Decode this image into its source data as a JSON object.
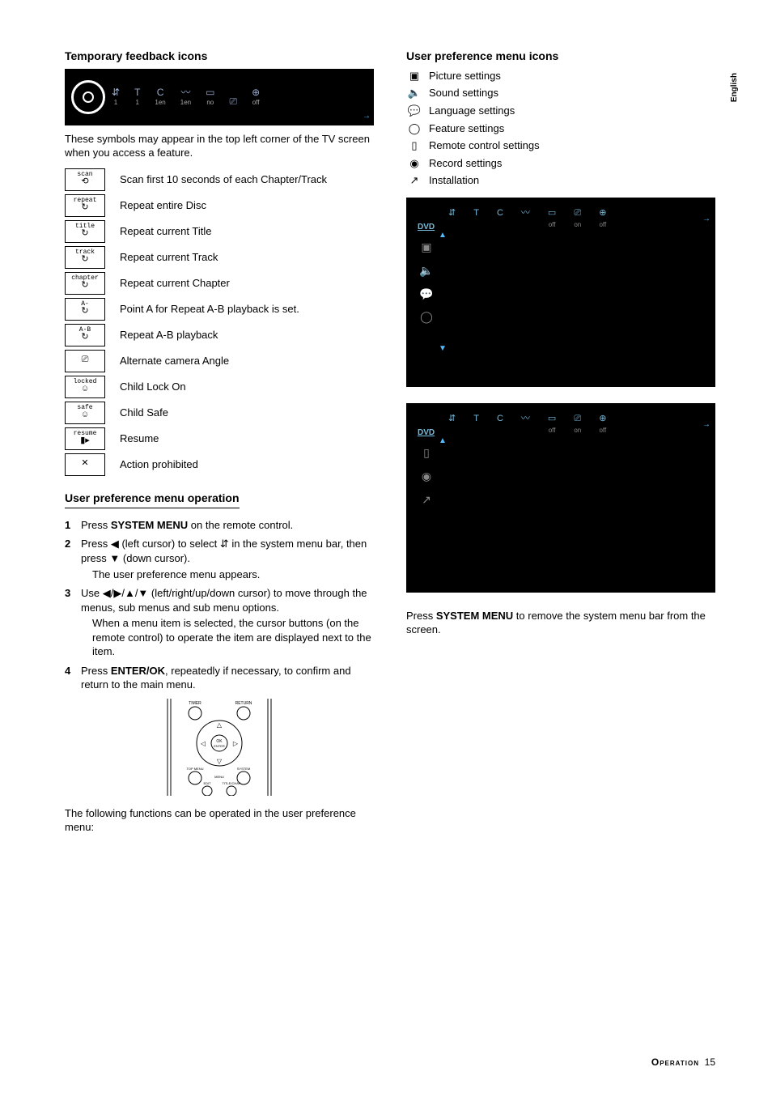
{
  "language_tab": "English",
  "left": {
    "heading1": "Temporary feedback icons",
    "bar_icons": [
      {
        "glyph": "⇵",
        "label": "1"
      },
      {
        "glyph": "T",
        "label": "1"
      },
      {
        "glyph": "C",
        "label": "1en"
      },
      {
        "glyph": "〰",
        "label": "1en"
      },
      {
        "glyph": "▭",
        "label": "no"
      },
      {
        "glyph": "⎚",
        "label": ""
      },
      {
        "glyph": "⊕",
        "label": "off"
      }
    ],
    "intro": "These symbols may appear in the top left corner of the TV screen when you access a feature.",
    "feedback_icons": [
      {
        "tag": "scan",
        "sym": "⟲",
        "desc": "Scan first 10 seconds of each Chapter/Track"
      },
      {
        "tag": "repeat",
        "sym": "↻",
        "desc": "Repeat entire Disc"
      },
      {
        "tag": "title",
        "sym": "↻",
        "desc": "Repeat current Title"
      },
      {
        "tag": "track",
        "sym": "↻",
        "desc": "Repeat current Track"
      },
      {
        "tag": "chapter",
        "sym": "↻",
        "desc": "Repeat current Chapter"
      },
      {
        "tag": "A-",
        "sym": "↻",
        "desc": "Point A for Repeat A-B playback is set."
      },
      {
        "tag": "A-B",
        "sym": "↻",
        "desc": "Repeat A-B playback"
      },
      {
        "tag": "",
        "sym": "⎚",
        "desc": "Alternate camera Angle"
      },
      {
        "tag": "locked",
        "sym": "☺",
        "desc": "Child Lock On"
      },
      {
        "tag": "safe",
        "sym": "☺",
        "desc": "Child Safe"
      },
      {
        "tag": "resume",
        "sym": "▮▸",
        "desc": "Resume"
      },
      {
        "tag": "",
        "sym": "✕",
        "desc": "Action prohibited"
      }
    ],
    "heading2": "User preference menu operation",
    "steps": {
      "s1_a": "Press ",
      "s1_b": "SYSTEM MENU",
      "s1_c": " on the remote control.",
      "s2_a": "Press ◀ (left cursor) to select  ⇵  in the system menu bar, then press ▼ (down cursor).",
      "s2_note": "The user preference menu appears.",
      "s3_a": "Use ◀/▶/▲/▼ (left/right/up/down cursor) to move through the menus, sub menus and sub menu options.",
      "s3_note": "When a menu item is selected, the cursor buttons (on the remote control) to operate the item are displayed next to the item.",
      "s4_a": "Press ",
      "s4_b": "ENTER/OK",
      "s4_c": ", repeatedly if necessary, to confirm and return to the main menu."
    },
    "remote_labels": {
      "timer": "TIMER",
      "return": "RETURN",
      "ok": "OK",
      "enter": "ENTER",
      "topmenu": "TOP MENU",
      "system": "SYSTEM",
      "menu": "MENU",
      "edit": "EDIT",
      "titlechap": "TITLE/CHAP"
    },
    "closing": "The following functions can be operated in the user preference menu:"
  },
  "right": {
    "heading": "User preference menu icons",
    "items": [
      {
        "glyph": "▣",
        "label": "Picture settings"
      },
      {
        "glyph": "🔈",
        "label": "Sound settings"
      },
      {
        "glyph": "💬",
        "label": "Language settings"
      },
      {
        "glyph": "◯",
        "label": "Feature settings"
      },
      {
        "glyph": "▯",
        "label": "Remote control settings"
      },
      {
        "glyph": "◉",
        "label": "Record settings"
      },
      {
        "glyph": "↗",
        "label": "Installation"
      }
    ],
    "menu_bar": [
      {
        "glyph": "⇵",
        "sub": ""
      },
      {
        "glyph": "T",
        "sub": ""
      },
      {
        "glyph": "C",
        "sub": ""
      },
      {
        "glyph": "〰",
        "sub": ""
      },
      {
        "glyph": "▭",
        "sub": "off"
      },
      {
        "glyph": "⎚",
        "sub": "on"
      },
      {
        "glyph": "⊕",
        "sub": "off"
      }
    ],
    "dvd": "DVD",
    "side_icons_a": [
      "▣",
      "🔈",
      "💬",
      "◯"
    ],
    "side_icons_b": [
      "▯",
      "◉",
      "↗"
    ],
    "closing_a": "Press ",
    "closing_b": "SYSTEM MENU",
    "closing_c": " to remove the system menu bar from the screen."
  },
  "footer": {
    "section": "Operation",
    "page": "15"
  }
}
